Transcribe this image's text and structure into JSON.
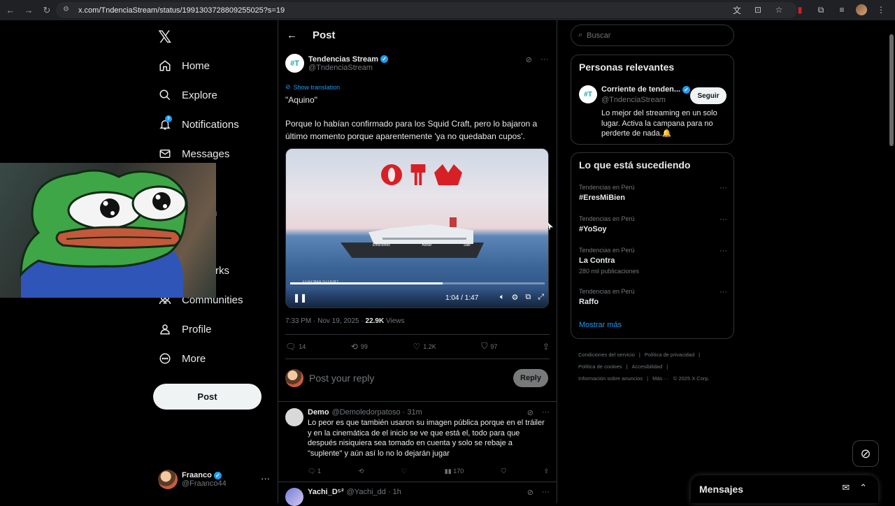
{
  "browser": {
    "url": "x.com/TndenciaStream/status/1991303728809255025?s=19"
  },
  "left_nav": {
    "items": [
      {
        "label": "Home",
        "icon": "home-icon"
      },
      {
        "label": "Explore",
        "icon": "search-icon"
      },
      {
        "label": "Notifications",
        "icon": "bell-icon"
      },
      {
        "label": "Messages",
        "icon": "mail-icon"
      },
      {
        "label": "Communities",
        "icon": "communities-icon"
      },
      {
        "label": "Profile",
        "icon": "person-icon"
      },
      {
        "label": "More",
        "icon": "more-circle-icon"
      }
    ],
    "partial_labels": {
      "grok_or_lists": "n",
      "bookmarks": "rks"
    },
    "notification_badge": "8",
    "post_button": "Post",
    "me": {
      "name": "Fraanco",
      "handle": "@Fraanco44"
    }
  },
  "post": {
    "header_title": "Post",
    "author_name": "Tendencias Stream",
    "author_handle": "@TndenciaStream",
    "show_translation": "Show translation",
    "text_line1": "\"Aquino\"",
    "text_line2": "Porque lo habían confirmado para los Squid Craft, pero lo bajaron a último momento porque aparentemente 'ya no quedaban cupos'.",
    "video": {
      "time": "1:04 / 1:47",
      "progress_fraction": 0.6,
      "ship_labels": [
        "Emociones",
        "Avisar",
        "Salir"
      ],
      "watermark": "EUFONIA STUDIO"
    },
    "timestamp": "7:33 PM · Nov 19, 2025 · ",
    "views_count": "22.9K",
    "views_label": " Views",
    "stats": {
      "replies": "14",
      "reposts": "99",
      "likes": "1.2K",
      "bookmarks": "97"
    },
    "reply_placeholder": "Post your reply",
    "reply_button": "Reply"
  },
  "comments": [
    {
      "name": "Demo",
      "handle": "@Demoledorpatoso · 31m",
      "text": "Lo peor es que también usaron su imagen pública porque en el tráiler y en la cinemática de el inicio se ve que está el, todo para que después nisiquiera sea tomado en cuenta y solo se rebaje a \"suplente\" y aún así lo no lo dejarán jugar",
      "replies": "1",
      "views": "170"
    },
    {
      "name": "Yachi_D⁵²",
      "handle": "@Yachi_dd · 1h"
    }
  ],
  "right": {
    "search_placeholder": "Buscar",
    "relevant_title": "Personas relevantes",
    "relevant": {
      "name": "Corriente de tenden...",
      "handle": "@TndenciaStream",
      "follow": "Seguir",
      "bio": "Lo mejor del streaming en un solo lugar. Activa la campana para no perderte de nada.🔔"
    },
    "trends_title": "Lo que está sucediendo",
    "trends": [
      {
        "category": "Tendencias en Perú",
        "name": "#EresMiBien",
        "count": ""
      },
      {
        "category": "Tendencias en Perú",
        "name": "#YoSoy",
        "count": ""
      },
      {
        "category": "Tendencias en Perú",
        "name": "La Contra",
        "count": "280 mil publicaciones"
      },
      {
        "category": "Tendencias en Perú",
        "name": "Raffo",
        "count": ""
      }
    ],
    "show_more": "Mostrar más",
    "footer": [
      "Condiciones del servicio",
      "|",
      "Política de privacidad",
      "|",
      "Política de cookies",
      "|",
      "Accesibilidad",
      "|",
      "Información sobre anuncios",
      "|",
      "Más ···",
      "© 2025 X Corp."
    ]
  },
  "messages_drawer": {
    "title": "Mensajes"
  },
  "colors": {
    "accent": "#1d9bf0",
    "background": "#000000",
    "border": "#2f3336",
    "muted": "#71767b"
  }
}
